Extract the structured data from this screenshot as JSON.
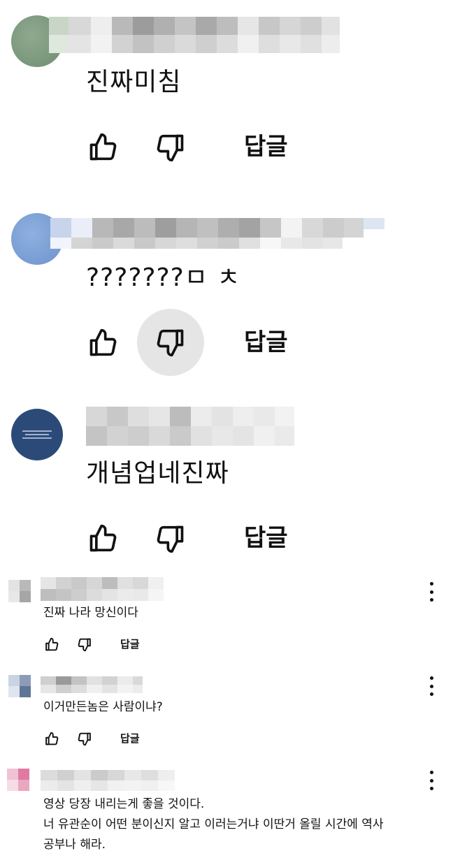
{
  "large_comments": [
    {
      "text": "진짜미침",
      "reply_label": "답글",
      "avatar_color": "#7e9b80",
      "dislike_highlighted": false
    },
    {
      "text": "???????ㅁ ㅊ",
      "reply_label": "답글",
      "avatar_color": "#7ea2d8",
      "dislike_highlighted": true
    },
    {
      "text": "개념업네진짜",
      "reply_label": "답글",
      "avatar_color": "#2c4a78",
      "dislike_highlighted": false
    }
  ],
  "small_comments": [
    {
      "lines": [
        "진짜 나라 망신이다"
      ],
      "reply_label": "답글"
    },
    {
      "lines": [
        "이거만든놈은 사람이냐?"
      ],
      "reply_label": "답글"
    },
    {
      "lines": [
        "영상 당장 내리는게 좋을 것이다.",
        "너 유관순이 어떤 분이신지 알고 이러는거냐 이딴거 올릴 시간에 역사",
        "공부나 해라."
      ]
    }
  ],
  "icons": {
    "like": "thumbs-up-icon",
    "dislike": "thumbs-down-icon",
    "more": "more-vertical-icon"
  }
}
